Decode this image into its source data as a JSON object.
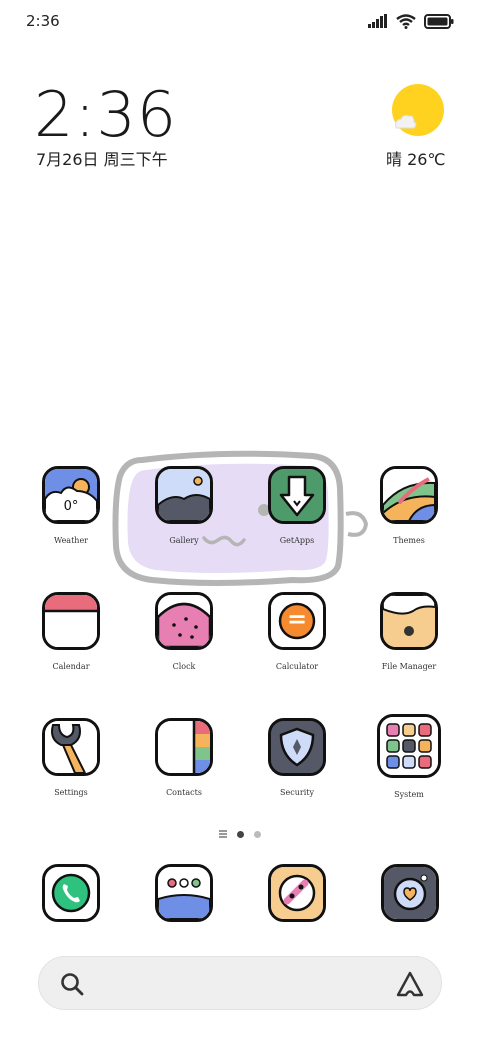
{
  "status_bar": {
    "time": "2:36",
    "icons": [
      "signal-icon",
      "wifi-icon",
      "battery-icon"
    ]
  },
  "clock_widget": {
    "time": "2:36",
    "date": "7月26日 周三下午",
    "weather": "晴 26℃"
  },
  "apps": {
    "weather": {
      "label": "Weather",
      "value": "0°"
    },
    "gallery": {
      "label": "Gallery"
    },
    "getapps": {
      "label": "GetApps"
    },
    "themes": {
      "label": "Themes"
    },
    "calendar": {
      "label": "Calendar"
    },
    "clock": {
      "label": "Clock"
    },
    "calculator": {
      "label": "Calculator",
      "glyph": "="
    },
    "file_manager": {
      "label": "File Manager"
    },
    "settings": {
      "label": "Settings"
    },
    "contacts": {
      "label": "Contacts"
    },
    "security": {
      "label": "Security"
    },
    "system": {
      "label": "System"
    }
  },
  "dock": [
    "phone-icon",
    "messages-icon",
    "browser-icon",
    "camera-icon"
  ],
  "pager": {
    "pages": 2,
    "active": 0
  },
  "colors": {
    "sun": "#ffd21f",
    "bubble": "#e6dcf5",
    "weather_sky": "#6f8fe6",
    "getapps_green": "#4f9a6b",
    "calendar_red": "#e86c7c",
    "clock_pink": "#e77fb3",
    "calculator_orange": "#f58b2e",
    "file_yellow": "#f7cc8f"
  }
}
